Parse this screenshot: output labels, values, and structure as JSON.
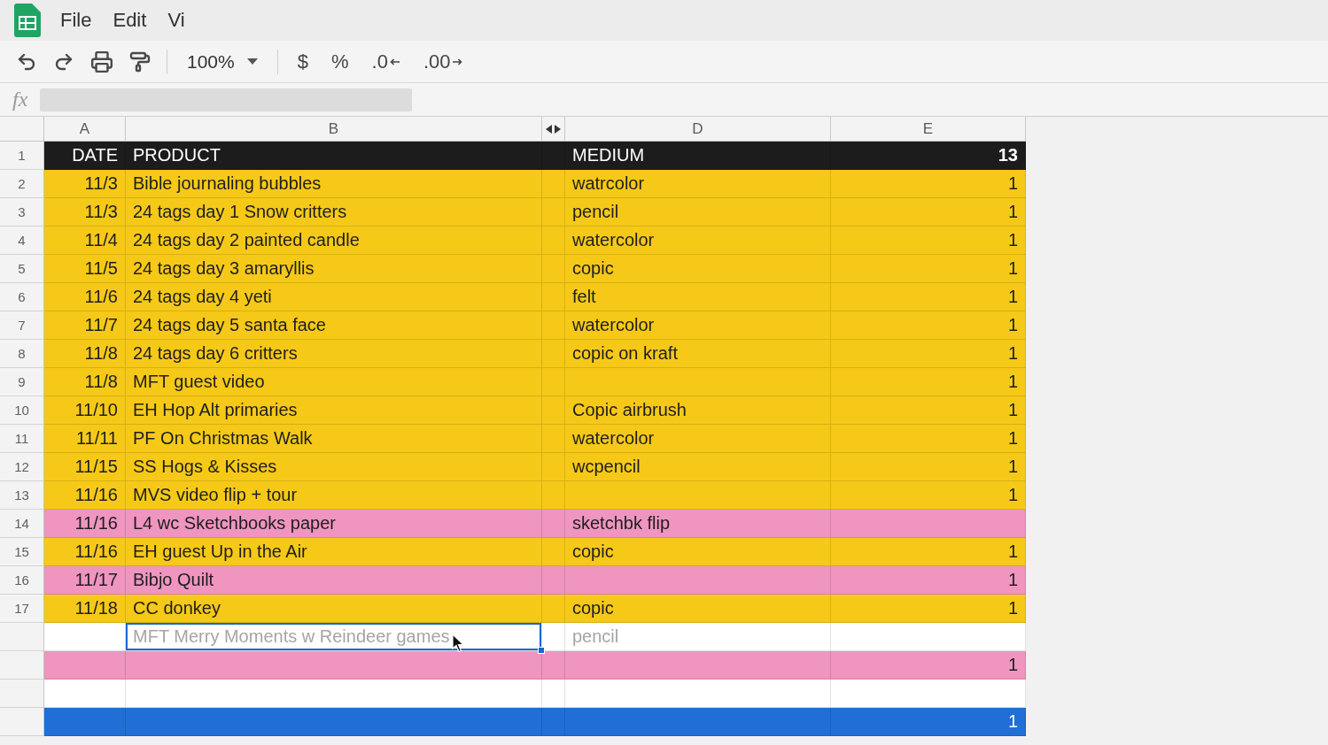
{
  "menu": [
    "File",
    "Edit",
    "Vi"
  ],
  "toolbar": {
    "zoom": "100%",
    "format_buttons": [
      {
        "label": "$",
        "kind": "plain"
      },
      {
        "label": "%",
        "kind": "plain"
      },
      {
        "label": ".0",
        "kind": "decimal_decrease"
      },
      {
        "label": ".00",
        "kind": "decimal_increase"
      }
    ]
  },
  "formula_bar": {
    "label": "fx"
  },
  "columns": [
    {
      "label": "A",
      "hidden": false
    },
    {
      "label": "B",
      "hidden": false
    },
    {
      "hidden": true
    },
    {
      "label": "D",
      "hidden": false
    },
    {
      "label": "E",
      "hidden": false
    }
  ],
  "rows": [
    {
      "number": "1",
      "kind": "header",
      "color": "#1c1c1c",
      "date": "DATE",
      "product": "PRODUCT",
      "medium": "MEDIUM",
      "count": "13",
      "selected": false,
      "dimmed": false
    },
    {
      "number": "2",
      "kind": "entry",
      "color": "#f6c918",
      "date": "11/3",
      "product": "Bible journaling bubbles",
      "medium": "watrcolor",
      "count": "1",
      "selected": false,
      "dimmed": false
    },
    {
      "number": "3",
      "kind": "entry",
      "color": "#f6c918",
      "date": "11/3",
      "product": "24 tags day 1 Snow critters",
      "medium": "pencil",
      "count": "1",
      "selected": false,
      "dimmed": false
    },
    {
      "number": "4",
      "kind": "entry",
      "color": "#f6c918",
      "date": "11/4",
      "product": "24 tags day 2 painted candle",
      "medium": "watercolor",
      "count": "1",
      "selected": false,
      "dimmed": false
    },
    {
      "number": "5",
      "kind": "entry",
      "color": "#f6c918",
      "date": "11/5",
      "product": "24 tags day 3 amaryllis",
      "medium": "copic",
      "count": "1",
      "selected": false,
      "dimmed": false
    },
    {
      "number": "6",
      "kind": "entry",
      "color": "#f6c918",
      "date": "11/6",
      "product": "24 tags day 4 yeti",
      "medium": "felt",
      "count": "1",
      "selected": false,
      "dimmed": false
    },
    {
      "number": "7",
      "kind": "entry",
      "color": "#f6c918",
      "date": "11/7",
      "product": "24 tags day 5 santa face",
      "medium": "watercolor",
      "count": "1",
      "selected": false,
      "dimmed": false
    },
    {
      "number": "8",
      "kind": "entry",
      "color": "#f6c918",
      "date": "11/8",
      "product": "24 tags day 6 critters",
      "medium": "copic on kraft",
      "count": "1",
      "selected": false,
      "dimmed": false
    },
    {
      "number": "9",
      "kind": "entry",
      "color": "#f6c918",
      "date": "11/8",
      "product": "MFT guest video",
      "count": "1",
      "selected": false,
      "dimmed": false
    },
    {
      "number": "10",
      "kind": "entry",
      "color": "#f6c918",
      "date": "11/10",
      "product": "EH Hop Alt primaries",
      "medium": "Copic airbrush",
      "count": "1",
      "selected": false,
      "dimmed": false
    },
    {
      "number": "11",
      "kind": "entry",
      "color": "#f6c918",
      "date": "11/11",
      "product": "PF On Christmas Walk",
      "medium": "watercolor",
      "count": "1",
      "selected": false,
      "dimmed": false
    },
    {
      "number": "12",
      "kind": "entry",
      "color": "#f6c918",
      "date": "11/15",
      "product": "SS Hogs & Kisses",
      "medium": "wcpencil",
      "count": "1",
      "selected": false,
      "dimmed": false
    },
    {
      "number": "13",
      "kind": "entry",
      "color": "#f6c918",
      "date": "11/16",
      "product": "MVS video flip + tour",
      "count": "1",
      "selected": false,
      "dimmed": false
    },
    {
      "number": "14",
      "kind": "entry",
      "color": "#ef95c0",
      "date": "11/16",
      "product": "L4 wc Sketchbooks paper",
      "medium": "sketchbk flip",
      "selected": false,
      "dimmed": false
    },
    {
      "number": "15",
      "kind": "entry",
      "color": "#f6c918",
      "date": "11/16",
      "product": "EH guest Up in the Air",
      "medium": "copic",
      "count": "1",
      "selected": false,
      "dimmed": false
    },
    {
      "number": "16",
      "kind": "entry",
      "color": "#ef95c0",
      "date": "11/17",
      "product": "Bibjo Quilt",
      "count": "1",
      "selected": false,
      "dimmed": false
    },
    {
      "number": "17",
      "kind": "entry",
      "color": "#f6c918",
      "date": "11/18",
      "product": "CC donkey",
      "medium": "copic",
      "count": "1",
      "selected": false,
      "dimmed": false
    },
    {
      "kind": "entry",
      "color": "#ffffff",
      "product": "MFT Merry Moments w Reindeer games",
      "medium": "pencil",
      "selected": true,
      "dimmed": true
    },
    {
      "kind": "entry",
      "color": "#ef95c0",
      "count": "1",
      "selected": false,
      "dimmed": false
    },
    {
      "kind": "entry",
      "color": "#ffffff",
      "selected": false
    },
    {
      "kind": "entry",
      "color": "#1f6fd6",
      "count": "1",
      "selected": false,
      "dimmed": false
    }
  ]
}
